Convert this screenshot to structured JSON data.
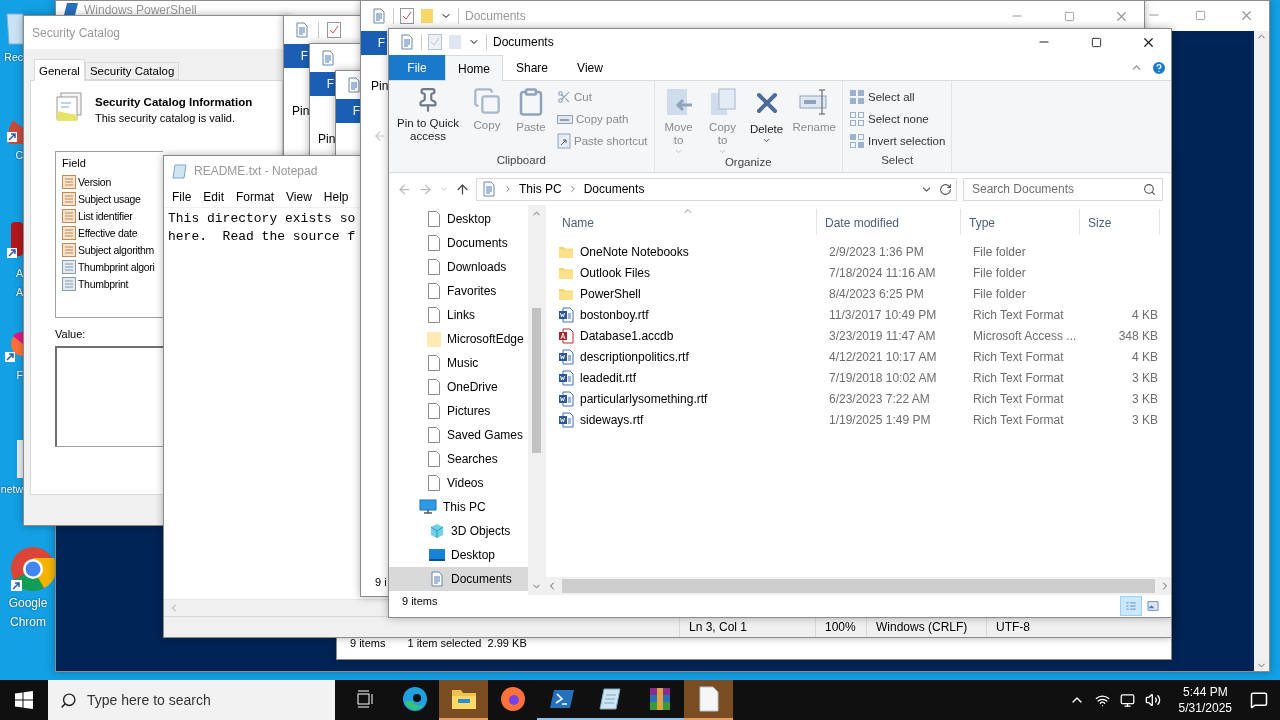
{
  "desktop_icons": [
    {
      "lines": [
        "Rec"
      ],
      "kind": "recycle"
    },
    {
      "lines": [
        "C"
      ],
      "kind": "shortcut"
    },
    {
      "lines": [
        "A",
        "A"
      ],
      "kind": "app"
    },
    {
      "lines": [
        "F"
      ],
      "kind": "firefox"
    },
    {
      "lines": [
        "netw"
      ],
      "kind": "network"
    },
    {
      "lines": [
        "Google",
        "Chrom"
      ],
      "kind": "chrome"
    }
  ],
  "console_window": {
    "title": "Windows PowerShell"
  },
  "back_explorer_status": {
    "count": "9 items",
    "selection": "1 item selected",
    "size": "2.99 KB"
  },
  "security_dialog": {
    "title": "Security Catalog",
    "tabs": [
      {
        "label": "General",
        "selected": true
      },
      {
        "label": "Security Catalog",
        "selected": false
      }
    ],
    "heading": "Security Catalog Information",
    "message": "This security catalog is valid.",
    "field_header": "Field",
    "fields": [
      {
        "label": "Version",
        "kind": "attribute"
      },
      {
        "label": "Subject usage",
        "kind": "attribute"
      },
      {
        "label": "List identifier",
        "kind": "attribute"
      },
      {
        "label": "Effective date",
        "kind": "attribute"
      },
      {
        "label": "Subject algorithm",
        "kind": "attribute"
      },
      {
        "label": "Thumbprint algori",
        "kind": "extension"
      },
      {
        "label": "Thumbprint",
        "kind": "extension"
      }
    ],
    "value_label": "Value:"
  },
  "stacked_windows": [
    {
      "tab": "F",
      "button": "Pin"
    },
    {
      "tab": "F",
      "button": "Pin"
    },
    {
      "tab": "F"
    }
  ],
  "notepad": {
    "title": "README.txt - Notepad",
    "menu": [
      "File",
      "Edit",
      "Format",
      "View",
      "Help"
    ],
    "lines": [
      "This directory exists so",
      "here.  Read the source f"
    ],
    "status": [
      "Ln 3, Col 1",
      "100%",
      "Windows (CRLF)",
      "UTF-8"
    ]
  },
  "middle_explorer": {
    "title": "Documents",
    "tab": "F",
    "button": "Pin",
    "status": "9 i"
  },
  "explorer": {
    "title": "Documents",
    "tabs": [
      {
        "label": "File",
        "kind": "file",
        "selected": false
      },
      {
        "label": "Home",
        "kind": "tab",
        "selected": true
      },
      {
        "label": "Share",
        "kind": "tab",
        "selected": false
      },
      {
        "label": "View",
        "kind": "tab",
        "selected": false
      }
    ],
    "ribbon_groups": [
      {
        "label": "Clipboard",
        "large": [
          {
            "label": "Pin to Quick access",
            "kind": "pin",
            "disabled": false
          },
          {
            "label": "Copy",
            "kind": "copy",
            "disabled": true
          },
          {
            "label": "Paste",
            "kind": "paste",
            "disabled": true
          }
        ],
        "small": [
          {
            "label": "Cut",
            "kind": "cut",
            "disabled": true
          },
          {
            "label": "Copy path",
            "kind": "path",
            "disabled": true
          },
          {
            "label": "Paste shortcut",
            "kind": "shortcut",
            "disabled": true
          }
        ]
      },
      {
        "label": "Organize",
        "large": [
          {
            "label": "Move to",
            "kind": "move",
            "disabled": true
          },
          {
            "label": "Copy to",
            "kind": "copyto",
            "disabled": true
          },
          {
            "label": "Delete",
            "kind": "delete",
            "disabled": false
          },
          {
            "label": "Rename",
            "kind": "rename",
            "disabled": true
          }
        ]
      },
      {
        "label": "Select",
        "small": [
          {
            "label": "Select all",
            "kind": "all",
            "disabled": false
          },
          {
            "label": "Select none",
            "kind": "none",
            "disabled": false
          },
          {
            "label": "Invert selection",
            "kind": "invert",
            "disabled": false
          }
        ]
      }
    ],
    "path": [
      "This PC",
      "Documents"
    ],
    "search": {
      "placeholder": "Search Documents"
    },
    "nav": [
      {
        "label": "Desktop",
        "kind": "page",
        "selected": false
      },
      {
        "label": "Documents",
        "kind": "page",
        "selected": false
      },
      {
        "label": "Downloads",
        "kind": "page",
        "selected": false
      },
      {
        "label": "Favorites",
        "kind": "page",
        "selected": false
      },
      {
        "label": "Links",
        "kind": "page",
        "selected": false
      },
      {
        "label": "MicrosoftEdge",
        "kind": "folder",
        "selected": false
      },
      {
        "label": "Music",
        "kind": "page",
        "selected": false
      },
      {
        "label": "OneDrive",
        "kind": "page",
        "selected": false
      },
      {
        "label": "Pictures",
        "kind": "page",
        "selected": false
      },
      {
        "label": "Saved Games",
        "kind": "page",
        "selected": false
      },
      {
        "label": "Searches",
        "kind": "page",
        "selected": false
      },
      {
        "label": "Videos",
        "kind": "page",
        "selected": false
      },
      {
        "label": "This PC",
        "kind": "pc",
        "selected": false,
        "children": [
          {
            "label": "3D Objects",
            "kind": "cube",
            "selected": false
          },
          {
            "label": "Desktop",
            "kind": "desktop",
            "selected": false
          },
          {
            "label": "Documents",
            "kind": "docs",
            "selected": true
          }
        ]
      }
    ],
    "columns": [
      "Name",
      "Date modified",
      "Type",
      "Size"
    ],
    "files": [
      {
        "name": "OneNote Notebooks",
        "date": "2/9/2023 1:36 PM",
        "type": "File folder",
        "kind": "folder"
      },
      {
        "name": "Outlook Files",
        "date": "7/18/2024 11:16 AM",
        "type": "File folder",
        "kind": "folder"
      },
      {
        "name": "PowerShell",
        "date": "8/4/2023 6:25 PM",
        "type": "File folder",
        "kind": "folder"
      },
      {
        "name": "bostonboy.rtf",
        "date": "11/3/2017 10:49 PM",
        "type": "Rich Text Format",
        "size": "4 KB",
        "kind": "rtf"
      },
      {
        "name": "Database1.accdb",
        "date": "3/23/2019 11:47 AM",
        "type": "Microsoft Access ...",
        "size": "348 KB",
        "kind": "access"
      },
      {
        "name": "descriptionpolitics.rtf",
        "date": "4/12/2021 10:17 AM",
        "type": "Rich Text Format",
        "size": "4 KB",
        "kind": "rtf"
      },
      {
        "name": "leadedit.rtf",
        "date": "7/19/2018 10:02 AM",
        "type": "Rich Text Format",
        "size": "3 KB",
        "kind": "rtf"
      },
      {
        "name": "particularlysomething.rtf",
        "date": "6/23/2023 7:22 AM",
        "type": "Rich Text Format",
        "size": "3 KB",
        "kind": "rtf"
      },
      {
        "name": "sideways.rtf",
        "date": "1/19/2025 1:49 PM",
        "type": "Rich Text Format",
        "size": "3 KB",
        "kind": "rtf"
      }
    ],
    "status": "9 items"
  },
  "taskbar": {
    "search": {
      "placeholder": "Type here to search"
    },
    "apps": [
      {
        "kind": "taskview",
        "active": false,
        "running": false
      },
      {
        "kind": "edge",
        "active": false,
        "running": false
      },
      {
        "kind": "explorer",
        "active": true,
        "running": true
      },
      {
        "kind": "firefox",
        "active": false,
        "running": false
      },
      {
        "kind": "powershell",
        "active": false,
        "running": true
      },
      {
        "kind": "notepad",
        "active": false,
        "running": true
      },
      {
        "kind": "archiver",
        "active": false,
        "running": true
      },
      {
        "kind": "document",
        "active": true,
        "running": true
      }
    ],
    "time": "5:44 PM",
    "date": "5/31/2025"
  }
}
